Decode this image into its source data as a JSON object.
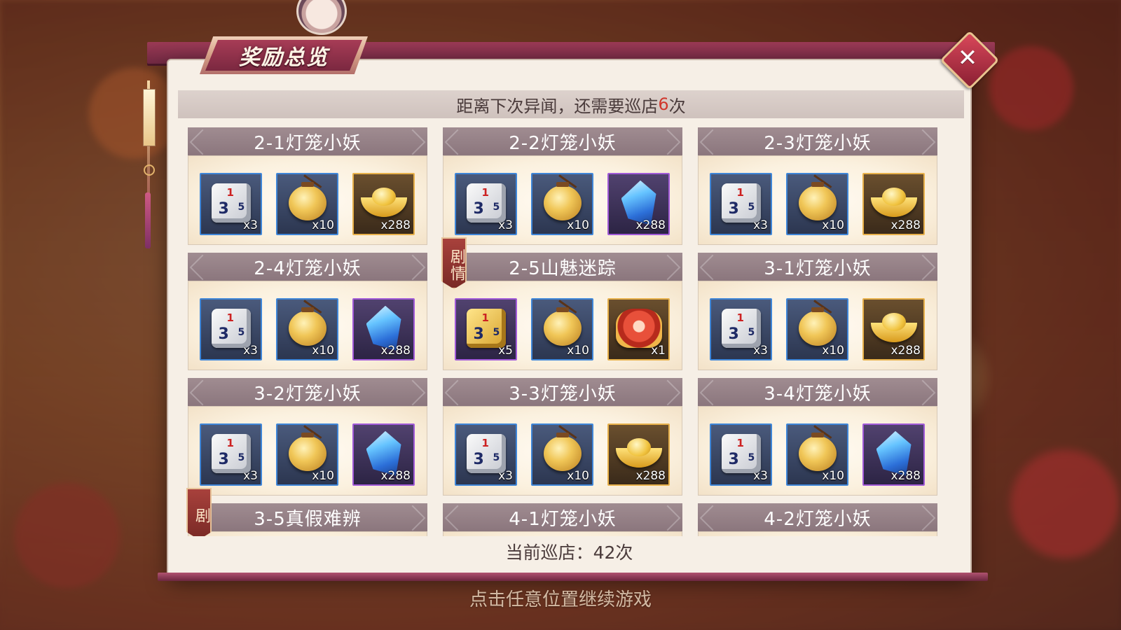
{
  "window": {
    "title": "奖励总览",
    "close_icon": "close-icon"
  },
  "info": {
    "prefix": "距离下次异闻，还需要巡店",
    "remaining": "6",
    "suffix": "次"
  },
  "stages": [
    {
      "title": "2-1灯笼小妖",
      "story": false,
      "items": [
        {
          "icon": "dice-icon",
          "tier": "blue",
          "count": "x3"
        },
        {
          "icon": "lantern-icon",
          "tier": "blue",
          "count": "x10"
        },
        {
          "icon": "gold-ingot-icon",
          "tier": "gold",
          "count": "x288"
        }
      ]
    },
    {
      "title": "2-2灯笼小妖",
      "story": false,
      "items": [
        {
          "icon": "dice-icon",
          "tier": "blue",
          "count": "x3"
        },
        {
          "icon": "lantern-icon",
          "tier": "blue",
          "count": "x10"
        },
        {
          "icon": "crystal-icon",
          "tier": "purple",
          "count": "x288"
        }
      ]
    },
    {
      "title": "2-3灯笼小妖",
      "story": false,
      "items": [
        {
          "icon": "dice-icon",
          "tier": "blue",
          "count": "x3"
        },
        {
          "icon": "lantern-icon",
          "tier": "blue",
          "count": "x10"
        },
        {
          "icon": "gold-ingot-icon",
          "tier": "gold",
          "count": "x288"
        }
      ]
    },
    {
      "title": "2-4灯笼小妖",
      "story": false,
      "items": [
        {
          "icon": "dice-icon",
          "tier": "blue",
          "count": "x3"
        },
        {
          "icon": "lantern-icon",
          "tier": "blue",
          "count": "x10"
        },
        {
          "icon": "crystal-icon",
          "tier": "purple",
          "count": "x288"
        }
      ]
    },
    {
      "title": "2-5山魅迷踪",
      "story": true,
      "story_label": "剧情",
      "items": [
        {
          "icon": "gold-dice-icon",
          "tier": "purple",
          "count": "x5"
        },
        {
          "icon": "lantern-icon",
          "tier": "blue",
          "count": "x10"
        },
        {
          "icon": "lion-dance-icon",
          "tier": "gold",
          "count": "x1"
        }
      ]
    },
    {
      "title": "3-1灯笼小妖",
      "story": false,
      "items": [
        {
          "icon": "dice-icon",
          "tier": "blue",
          "count": "x3"
        },
        {
          "icon": "lantern-icon",
          "tier": "blue",
          "count": "x10"
        },
        {
          "icon": "gold-ingot-icon",
          "tier": "gold",
          "count": "x288"
        }
      ]
    },
    {
      "title": "3-2灯笼小妖",
      "story": false,
      "items": [
        {
          "icon": "dice-icon",
          "tier": "blue",
          "count": "x3"
        },
        {
          "icon": "lantern-icon",
          "tier": "blue",
          "count": "x10"
        },
        {
          "icon": "crystal-icon",
          "tier": "purple",
          "count": "x288"
        }
      ]
    },
    {
      "title": "3-3灯笼小妖",
      "story": false,
      "items": [
        {
          "icon": "dice-icon",
          "tier": "blue",
          "count": "x3"
        },
        {
          "icon": "lantern-icon",
          "tier": "blue",
          "count": "x10"
        },
        {
          "icon": "gold-ingot-icon",
          "tier": "gold",
          "count": "x288"
        }
      ]
    },
    {
      "title": "3-4灯笼小妖",
      "story": false,
      "items": [
        {
          "icon": "dice-icon",
          "tier": "blue",
          "count": "x3"
        },
        {
          "icon": "lantern-icon",
          "tier": "blue",
          "count": "x10"
        },
        {
          "icon": "crystal-icon",
          "tier": "purple",
          "count": "x288"
        }
      ]
    },
    {
      "title": "3-5真假难辨",
      "story": true,
      "story_label": "剧",
      "items": []
    },
    {
      "title": "4-1灯笼小妖",
      "story": false,
      "items": []
    },
    {
      "title": "4-2灯笼小妖",
      "story": false,
      "items": []
    }
  ],
  "footer": {
    "current_label": "当前巡店：",
    "current_value": "42次"
  },
  "continue_hint": "点击任意位置继续游戏",
  "colors": {
    "accent_red": "#d0362c",
    "frame_purple": "#9b3a55",
    "tier_blue": "#3f86d8",
    "tier_purple": "#a15ad8",
    "tier_gold": "#e7b04a"
  }
}
